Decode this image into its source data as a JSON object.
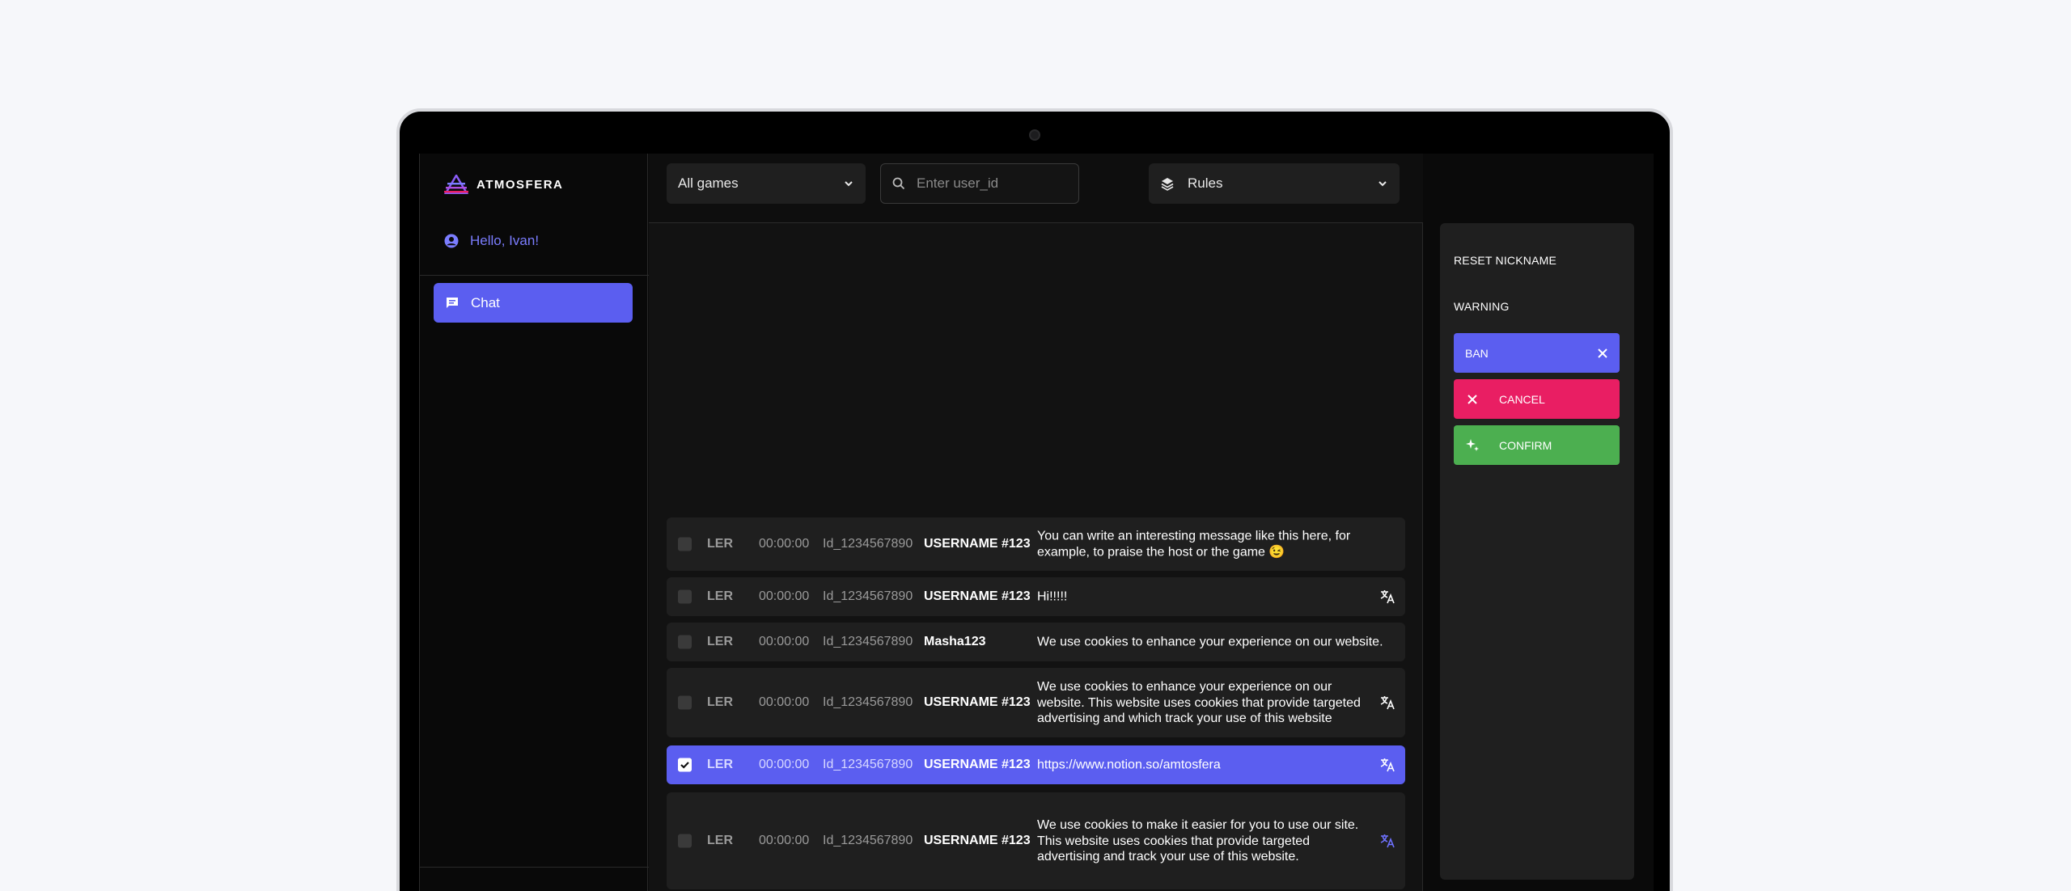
{
  "brand": {
    "name": "ATMOSFERA",
    "accent": "#5b5ef0"
  },
  "sidebar": {
    "greeting": "Hello, Ivan!",
    "nav": [
      {
        "label": "Chat",
        "icon": "chat-icon",
        "active": true
      }
    ]
  },
  "topbar": {
    "game_select": "All games",
    "search_placeholder": "Enter user_id",
    "rules_select": "Rules"
  },
  "messages": [
    {
      "ler": "LER",
      "time": "00:00:00",
      "id": "Id_1234567890",
      "user": "USERNAME #123",
      "text": "You can write an interesting message like this here, for example, to praise the host or the game 😉",
      "translate": false,
      "selected": false
    },
    {
      "ler": "LER",
      "time": "00:00:00",
      "id": "Id_1234567890",
      "user": "USERNAME #123",
      "text": "Hi!!!!!",
      "translate": true,
      "selected": false
    },
    {
      "ler": "LER",
      "time": "00:00:00",
      "id": "Id_1234567890",
      "user": "Masha123",
      "text": "We use cookies to enhance your experience on our website.",
      "translate": false,
      "selected": false
    },
    {
      "ler": "LER",
      "time": "00:00:00",
      "id": "Id_1234567890",
      "user": "USERNAME #123",
      "text": "We use cookies to enhance your experience on our website. This website uses cookies that provide targeted advertising and which track your use of this website",
      "translate": true,
      "selected": false
    },
    {
      "ler": "LER",
      "time": "00:00:00",
      "id": "Id_1234567890",
      "user": "USERNAME #123",
      "text": "https://www.notion.so/amtosfera",
      "translate": true,
      "selected": true
    },
    {
      "ler": "LER",
      "time": "00:00:00",
      "id": "Id_1234567890",
      "user": "USERNAME #123",
      "text": "We use cookies to make it easier for you to use our site. This website uses cookies that provide targeted advertising and track your use of this website.",
      "translate": true,
      "selected": false,
      "translate_accent": true
    }
  ],
  "actions": {
    "reset_nickname": "RESET NICKNAME",
    "warning": "WARNING",
    "ban": "BAN",
    "cancel": "CANCEL",
    "confirm": "CONFIRM",
    "colors": {
      "ban": "#5b5ef0",
      "cancel": "#e91e63",
      "confirm": "#4caf50"
    }
  }
}
